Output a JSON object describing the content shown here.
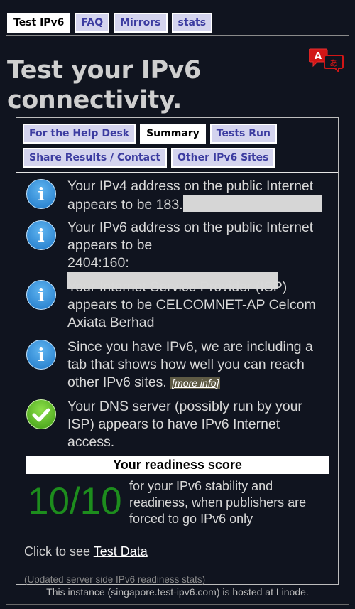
{
  "top_tabs": [
    {
      "label": "Test IPv6",
      "active": true
    },
    {
      "label": "FAQ"
    },
    {
      "label": "Mirrors"
    },
    {
      "label": "stats"
    }
  ],
  "title": "Test your IPv6 connectivity.",
  "result_tabs": [
    {
      "label": "For the Help Desk"
    },
    {
      "label": "Summary",
      "active": true
    },
    {
      "label": "Tests Run"
    },
    {
      "label": "Share Results / Contact"
    },
    {
      "label": "Other IPv6 Sites"
    }
  ],
  "items": {
    "ipv4": {
      "icon": "info-icon",
      "text": "Your IPv4 address on the public Internet appears to be 183."
    },
    "ipv6": {
      "icon": "info-icon",
      "text_line1": "Your IPv6 address on the public Internet appears to be",
      "text_line2": "2404:160:"
    },
    "isp": {
      "icon": "info-icon",
      "text": "Your Internet Service Provider (ISP) appears to be CELCOMNET-AP Celcom Axiata Berhad"
    },
    "tab_note": {
      "icon": "info-icon",
      "text": "Since you have IPv6, we are including a tab that shows how well you can reach other IPv6 sites.",
      "more": "[more info]"
    },
    "dns": {
      "icon": "check-icon",
      "text": "Your DNS server (possibly run by your ISP) appears to have IPv6 Internet access."
    }
  },
  "score": {
    "header": "Your readiness score",
    "value": "10/10",
    "description": "for your IPv6 stability and readiness, when publishers are forced to go IPv6 only"
  },
  "test_data": {
    "prefix": "Click to see ",
    "link": "Test Data"
  },
  "updated": "(Updated server side IPv6 readiness stats)",
  "footer": "This instance (singapore.test-ipv6.com) is hosted at Linode.",
  "colors": {
    "background": "#10141f",
    "tab_bg": "#d4d4ee",
    "tab_text": "#3c3ca0",
    "score_green": "#1d8d1d",
    "translate_red": "#d11616"
  }
}
